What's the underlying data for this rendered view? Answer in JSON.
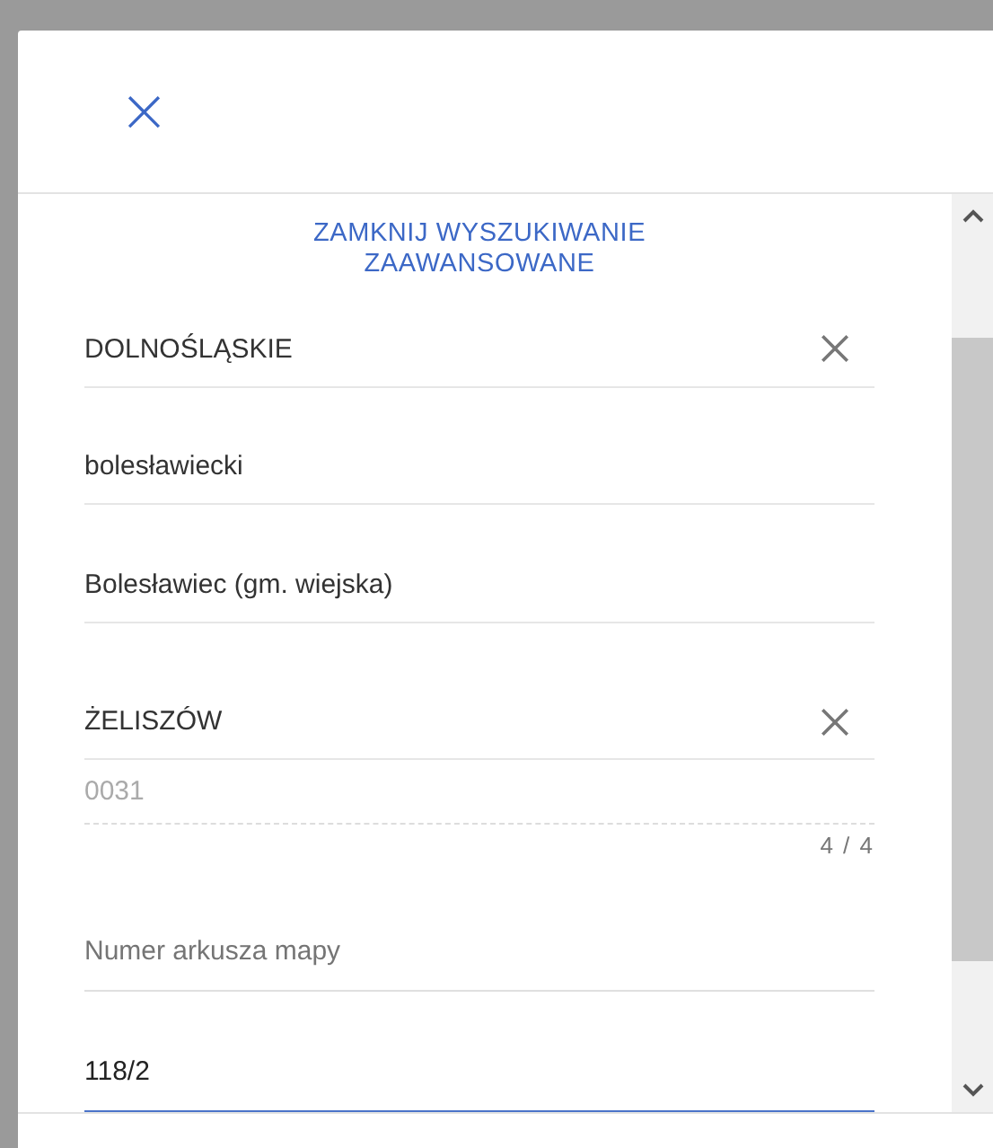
{
  "dialog": {
    "close_icon": "×",
    "collapse_link": "ZAMKNIJ WYSZUKIWANIE ZAAWANSOWANE",
    "fields": [
      {
        "kind": "select",
        "value": "DOLNOŚLĄSKIE",
        "clearable": true
      },
      {
        "kind": "select",
        "value": "bolesławiecki",
        "clearable": false
      },
      {
        "kind": "select",
        "value": "Bolesławiec (gm. wiejska)",
        "clearable": false
      },
      {
        "kind": "select",
        "value": "ŻELISZÓW",
        "clearable": true
      },
      {
        "kind": "input",
        "value": "0031",
        "disabled": true,
        "counter": "4 / 4"
      },
      {
        "kind": "input",
        "placeholder": "Numer arkusza mapy",
        "disabled": false
      },
      {
        "kind": "input",
        "value": "118/2",
        "disabled": false,
        "focused": true
      }
    ]
  }
}
